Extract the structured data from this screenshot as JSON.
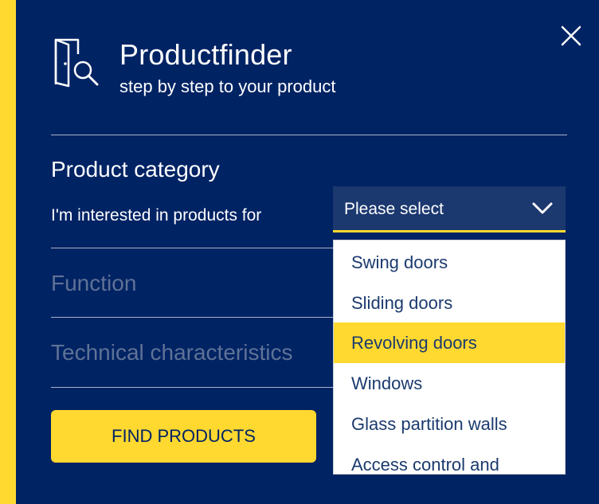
{
  "header": {
    "title": "Productfinder",
    "subtitle": "step by step to your product"
  },
  "category": {
    "heading": "Product category",
    "question": "I'm interested in products for",
    "select": {
      "value": "Please select",
      "options": [
        "Swing doors",
        "Sliding doors",
        "Revolving doors",
        "Windows",
        "Glass partition walls",
        "Access control and"
      ],
      "highlighted": "Revolving doors"
    }
  },
  "sections": {
    "function": "Function",
    "technical": "Technical characteristics"
  },
  "actions": {
    "find_label": "FIND PRODUCTS"
  },
  "icons": {
    "logo": "door-search-icon",
    "close": "close-icon",
    "chevron": "chevron-down-icon"
  },
  "colors": {
    "background": "#002364",
    "accent": "#ffd830",
    "select_background": "#1b386f",
    "disabled_text": "#5f7296",
    "dropdown_text": "#1b3a6e"
  }
}
